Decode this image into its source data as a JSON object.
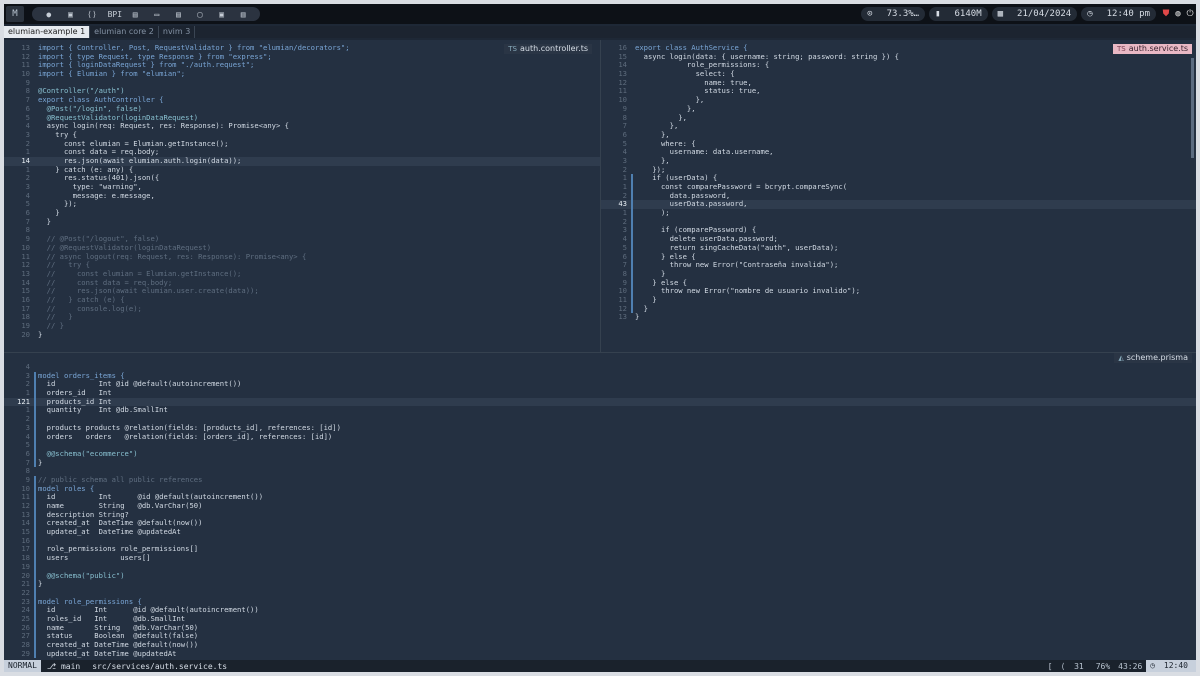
{
  "topbar": {
    "workspace": "M",
    "apps": [
      "●",
      "▣",
      "⟨⟩",
      "BPI",
      "▤",
      "▭",
      "▤",
      "▢",
      "▣",
      "▥"
    ],
    "stats": {
      "cpu": "73.3%…",
      "mem": "6140M",
      "date": "21/04/2024",
      "time": "12:40 pm"
    }
  },
  "tabs": [
    {
      "label": "elumian-example 1",
      "active": true
    },
    {
      "label": "elumian core 2",
      "active": false
    },
    {
      "label": "nvim 3",
      "active": false
    }
  ],
  "panes": {
    "left": {
      "filename": "auth.controller.ts",
      "lines": [
        {
          "n": "13",
          "t": "import { Controller, Post, RequestValidator } from \"elumian/decorators\";"
        },
        {
          "n": "12",
          "t": "import { type Request, type Response } from \"express\";"
        },
        {
          "n": "11",
          "t": "import { loginDataRequest } from \"./auth.request\";"
        },
        {
          "n": "10",
          "t": "import { Elumian } from \"elumian\";"
        },
        {
          "n": "9",
          "t": ""
        },
        {
          "n": "8",
          "t": "@Controller(\"/auth\")"
        },
        {
          "n": "7",
          "t": "export class AuthController {"
        },
        {
          "n": "6",
          "t": "  @Post(\"/login\", false)"
        },
        {
          "n": "5",
          "t": "  @RequestValidator(loginDataRequest)"
        },
        {
          "n": "4",
          "t": "  async login(req: Request, res: Response): Promise<any> {"
        },
        {
          "n": "3",
          "t": "    try {"
        },
        {
          "n": "2",
          "t": "      const elumian = Elumian.getInstance();"
        },
        {
          "n": "1",
          "t": "      const data = req.body;"
        },
        {
          "n": "14",
          "t": "      res.json(await elumian.auth.login(data));",
          "cur": true
        },
        {
          "n": "1",
          "t": "    } catch (e: any) {"
        },
        {
          "n": "2",
          "t": "      res.status(401).json({"
        },
        {
          "n": "3",
          "t": "        type: \"warning\","
        },
        {
          "n": "4",
          "t": "        message: e.message,"
        },
        {
          "n": "5",
          "t": "      });"
        },
        {
          "n": "6",
          "t": "    }"
        },
        {
          "n": "7",
          "t": "  }"
        },
        {
          "n": "8",
          "t": ""
        },
        {
          "n": "9",
          "t": "  // @Post(\"/logout\", false)"
        },
        {
          "n": "10",
          "t": "  // @RequestValidator(loginDataRequest)"
        },
        {
          "n": "11",
          "t": "  // async logout(req: Request, res: Response): Promise<any> {"
        },
        {
          "n": "12",
          "t": "  //   try {"
        },
        {
          "n": "13",
          "t": "  //     const elumian = Elumian.getInstance();"
        },
        {
          "n": "14",
          "t": "  //     const data = req.body;"
        },
        {
          "n": "15",
          "t": "  //     res.json(await elumian.user.create(data));"
        },
        {
          "n": "16",
          "t": "  //   } catch (e) {"
        },
        {
          "n": "17",
          "t": "  //     console.log(e);"
        },
        {
          "n": "18",
          "t": "  //   }"
        },
        {
          "n": "19",
          "t": "  // }"
        },
        {
          "n": "20",
          "t": "}"
        }
      ]
    },
    "right": {
      "filename": "auth.service.ts",
      "lines": [
        {
          "n": "16",
          "t": "export class AuthService {"
        },
        {
          "n": "15",
          "t": "  async login(data: { username: string; password: string }) {"
        },
        {
          "n": "14",
          "t": "            role_permissions: {"
        },
        {
          "n": "13",
          "t": "              select: {"
        },
        {
          "n": "12",
          "t": "                name: true,"
        },
        {
          "n": "11",
          "t": "                status: true,"
        },
        {
          "n": "10",
          "t": "              },"
        },
        {
          "n": "9",
          "t": "            },"
        },
        {
          "n": "8",
          "t": "          },"
        },
        {
          "n": "7",
          "t": "        },"
        },
        {
          "n": "6",
          "t": "      },"
        },
        {
          "n": "5",
          "t": "      where: {"
        },
        {
          "n": "4",
          "t": "        username: data.username,"
        },
        {
          "n": "3",
          "t": "      },"
        },
        {
          "n": "2",
          "t": "    });"
        },
        {
          "n": "1",
          "t": "    if (userData) {"
        },
        {
          "n": "1",
          "t": "      const comparePassword = bcrypt.compareSync("
        },
        {
          "n": "2",
          "t": "        data.password,"
        },
        {
          "n": "43",
          "t": "        userData.password,",
          "cur": true
        },
        {
          "n": "1",
          "t": "      );"
        },
        {
          "n": "2",
          "t": ""
        },
        {
          "n": "3",
          "t": "      if (comparePassword) {"
        },
        {
          "n": "4",
          "t": "        delete userData.password;"
        },
        {
          "n": "5",
          "t": "        return singCacheData(\"auth\", userData);"
        },
        {
          "n": "6",
          "t": "      } else {"
        },
        {
          "n": "7",
          "t": "        throw new Error(\"Contraseña invalida\");"
        },
        {
          "n": "8",
          "t": "      }"
        },
        {
          "n": "9",
          "t": "    } else {"
        },
        {
          "n": "10",
          "t": "      throw new Error(\"nombre de usuario invalido\");"
        },
        {
          "n": "11",
          "t": "    }"
        },
        {
          "n": "12",
          "t": "  }"
        },
        {
          "n": "13",
          "t": "}"
        }
      ]
    },
    "bottom": {
      "filename": "scheme.prisma",
      "lines": [
        {
          "n": "4",
          "t": ""
        },
        {
          "n": "3",
          "t": "model orders_items {"
        },
        {
          "n": "2",
          "t": "  id          Int @id @default(autoincrement())"
        },
        {
          "n": "1",
          "t": "  orders_id   Int"
        },
        {
          "n": "121",
          "t": "  products_id Int",
          "cur": true
        },
        {
          "n": "1",
          "t": "  quantity    Int @db.SmallInt"
        },
        {
          "n": "2",
          "t": ""
        },
        {
          "n": "3",
          "t": "  products products @relation(fields: [products_id], references: [id])"
        },
        {
          "n": "4",
          "t": "  orders   orders   @relation(fields: [orders_id], references: [id])"
        },
        {
          "n": "5",
          "t": ""
        },
        {
          "n": "6",
          "t": "  @@schema(\"ecommerce\")"
        },
        {
          "n": "7",
          "t": "}"
        },
        {
          "n": "8",
          "t": ""
        },
        {
          "n": "9",
          "t": "// public schema all public references"
        },
        {
          "n": "10",
          "t": "model roles {"
        },
        {
          "n": "11",
          "t": "  id          Int      @id @default(autoincrement())"
        },
        {
          "n": "12",
          "t": "  name        String   @db.VarChar(50)"
        },
        {
          "n": "13",
          "t": "  description String?"
        },
        {
          "n": "14",
          "t": "  created_at  DateTime @default(now())"
        },
        {
          "n": "15",
          "t": "  updated_at  DateTime @updatedAt"
        },
        {
          "n": "16",
          "t": ""
        },
        {
          "n": "17",
          "t": "  role_permissions role_permissions[]"
        },
        {
          "n": "18",
          "t": "  users            users[]"
        },
        {
          "n": "19",
          "t": ""
        },
        {
          "n": "20",
          "t": "  @@schema(\"public\")"
        },
        {
          "n": "21",
          "t": "}"
        },
        {
          "n": "22",
          "t": ""
        },
        {
          "n": "23",
          "t": "model role_permissions {"
        },
        {
          "n": "24",
          "t": "  id         Int      @id @default(autoincrement())"
        },
        {
          "n": "25",
          "t": "  roles_id   Int      @db.SmallInt"
        },
        {
          "n": "26",
          "t": "  name       String   @db.VarChar(50)"
        },
        {
          "n": "27",
          "t": "  status     Boolean  @default(false)"
        },
        {
          "n": "28",
          "t": "  created_at DateTime @default(now())"
        },
        {
          "n": "29",
          "t": "  updated_at DateTime @updatedAt"
        }
      ]
    }
  },
  "statusbar": {
    "mode": "NORMAL",
    "branch": "main",
    "path": "src/services/auth.service.ts",
    "lsp": "[",
    "errors": "31",
    "percent": "76%",
    "position": "43:26",
    "time": "12:40"
  }
}
